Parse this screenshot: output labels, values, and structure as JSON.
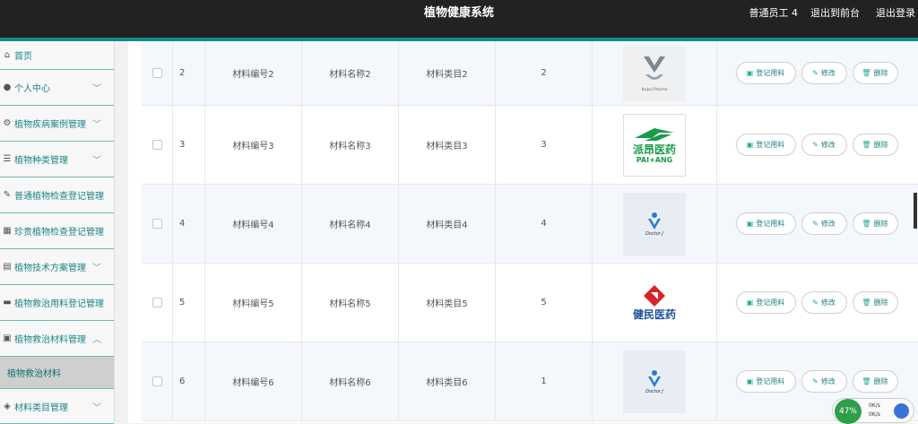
{
  "header": {
    "title": "植物健康系统",
    "user": "普通员工 4",
    "front_link": "退出到前台",
    "logout_link": "退出登录"
  },
  "sidebar": {
    "items": [
      {
        "icon": "home-icon",
        "label": "首页",
        "chevron": false
      },
      {
        "icon": "person-icon",
        "label": "个人中心",
        "chevron": true
      },
      {
        "icon": "settings-icon",
        "label": "植物疾病案例管理",
        "chevron": true
      },
      {
        "icon": "list-icon",
        "label": "植物种类管理",
        "chevron": true
      },
      {
        "icon": "edit-icon",
        "label": "普通植物检查登记管理",
        "chevron": false
      },
      {
        "icon": "grid-icon",
        "label": "珍贵植物检查登记管理",
        "chevron": false
      },
      {
        "icon": "doc-icon",
        "label": "植物技术方案管理",
        "chevron": true
      },
      {
        "icon": "folder-icon",
        "label": "植物救治用料登记管理",
        "chevron": false
      },
      {
        "icon": "box-icon",
        "label": "植物救治材料管理",
        "chevron": true,
        "expanded": true
      },
      {
        "icon": "",
        "label": "植物救治材料",
        "sub": true
      },
      {
        "icon": "tag-icon",
        "label": "材料类目管理",
        "chevron": true
      }
    ]
  },
  "table": {
    "rows": [
      {
        "no": "2",
        "code": "材料编号2",
        "name": "材料名称2",
        "category": "材料类目2",
        "qty": "2",
        "image": "logo-silver"
      },
      {
        "no": "3",
        "code": "材料编号3",
        "name": "材料名称3",
        "category": "材料类目3",
        "qty": "3",
        "image": "logo-paiang"
      },
      {
        "no": "4",
        "code": "材料编号4",
        "name": "材料名称4",
        "category": "材料类目4",
        "qty": "4",
        "image": "logo-doctorj"
      },
      {
        "no": "5",
        "code": "材料编号5",
        "name": "材料名称5",
        "category": "材料类目5",
        "qty": "5",
        "image": "logo-jianmin"
      },
      {
        "no": "6",
        "code": "材料编号6",
        "name": "材料名称6",
        "category": "材料类目6",
        "qty": "1",
        "image": "logo-doctorj"
      }
    ],
    "actions": {
      "register": "登记用料",
      "edit": "修改",
      "delete": "删除"
    }
  },
  "logos": {
    "paiang_cn": "派昂医药",
    "paiang_en": "PAI+ANG",
    "jianmin_cn": "健民医药",
    "doctorj": "Doctor J",
    "silver_caption": "Kaipai Pharma"
  },
  "net_widget": {
    "percent": "47%",
    "up": "0K/s",
    "down": "0K/s"
  },
  "colors": {
    "accent": "#148b8b",
    "topbar": "#222222"
  }
}
